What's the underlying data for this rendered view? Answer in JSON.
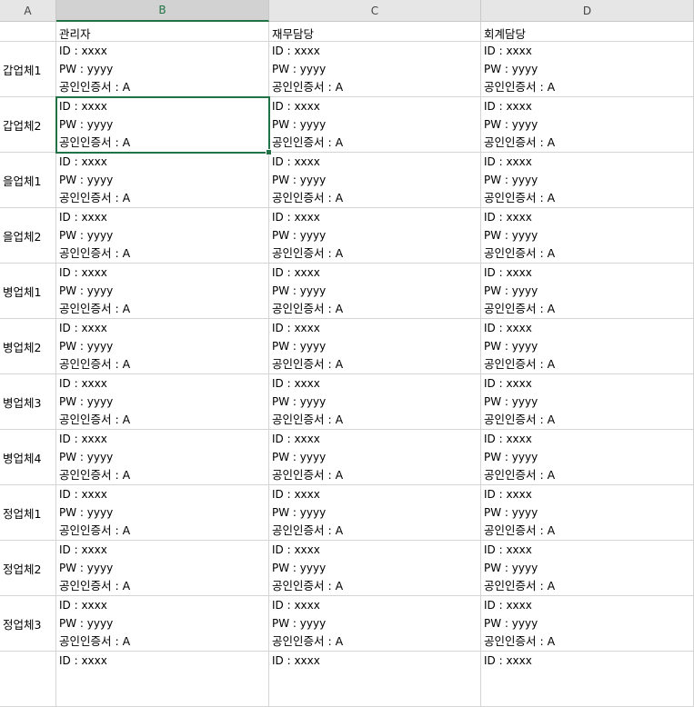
{
  "columns": [
    "A",
    "B",
    "C",
    "D"
  ],
  "selected_column": "B",
  "header_row": [
    "",
    "관리자",
    "재무담당",
    "회계담당"
  ],
  "cell_lines": [
    "ID : xxxx",
    "PW : yyyy",
    "공인인증서 : A"
  ],
  "rows": [
    {
      "label": "갑업체1"
    },
    {
      "label": "갑업체2",
      "selected_cell": "B"
    },
    {
      "label": "을업체1"
    },
    {
      "label": "을업체2"
    },
    {
      "label": "병업체1"
    },
    {
      "label": "병업체2"
    },
    {
      "label": "병업체3"
    },
    {
      "label": "병업체4"
    },
    {
      "label": "정업체1"
    },
    {
      "label": "정업체2"
    },
    {
      "label": "정업체3"
    },
    {
      "label": "",
      "partial": true
    }
  ]
}
